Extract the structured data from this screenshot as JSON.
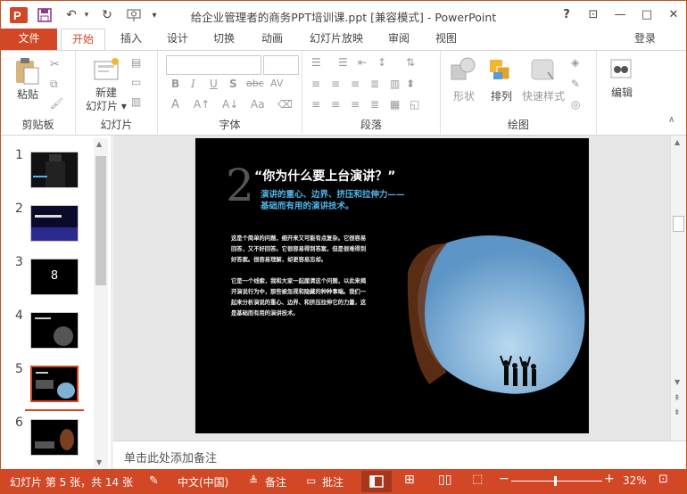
{
  "title": "给企业管理者的商务PPT培训课.ppt [兼容模式] - PowerPoint",
  "window": {
    "help": "?",
    "restore_ribbon": "⊡",
    "minimize": "—",
    "maximize": "□",
    "close": "✕"
  },
  "tabs": [
    "文件",
    "开始",
    "插入",
    "设计",
    "切换",
    "动画",
    "幻灯片放映",
    "审阅",
    "视图"
  ],
  "active_tab": "开始",
  "login": "登录",
  "ribbon": {
    "clipboard": {
      "paste": "粘贴",
      "label": "剪贴板"
    },
    "slides": {
      "new_slide_line1": "新建",
      "new_slide_line2": "幻灯片",
      "label": "幻灯片"
    },
    "font": {
      "label": "字体",
      "bold": "B",
      "italic": "I",
      "underline": "U",
      "shadow": "S",
      "strike": "abc",
      "spacing": "AV"
    },
    "paragraph": {
      "label": "段落"
    },
    "drawing": {
      "shapes": "形状",
      "arrange": "排列",
      "quick_styles": "快速样式",
      "label": "绘图"
    },
    "editing": {
      "label": "编辑"
    }
  },
  "thumbnails": [
    {
      "num": "1",
      "text": ""
    },
    {
      "num": "2",
      "text": ""
    },
    {
      "num": "3",
      "text": "8"
    },
    {
      "num": "4",
      "text": ""
    },
    {
      "num": "5",
      "text": ""
    },
    {
      "num": "6",
      "text": ""
    }
  ],
  "slide": {
    "number": "2",
    "heading": "“你为什么要上台演讲？”",
    "subheading_1": "演讲的重心、边界、挤压和拉伸力——",
    "subheading_2": "基础而有用的演讲技术。",
    "body_1a": "这是个简单的问题，细开来又可能有点复杂。它很容易",
    "body_1b": "回答，又不好回答。它很容易得到答案，但是很难得到",
    "body_1c": "好答案。很容易理解，却更容易忘却。",
    "body_2a": "它是一个线索，我和大家一起厘清这个问题，以此来揭",
    "body_2b": "开演说行为中，那些被忽视和隐藏的种种事端。我们一",
    "body_2c": "起来分析演说的重心、边界、和挤压拉伸它的力量，这",
    "body_2d": "是基础而有用的演讲技术。"
  },
  "notes_placeholder": "单击此处添加备注",
  "status": {
    "slide_info": "幻灯片 第 5 张，共 14 张",
    "language": "中文(中国)",
    "notes": "备注",
    "comments": "批注",
    "zoom": "32%",
    "zoom_level": 0.32
  },
  "colors": {
    "accent": "#d24726",
    "subheading": "#4fb4e8"
  }
}
